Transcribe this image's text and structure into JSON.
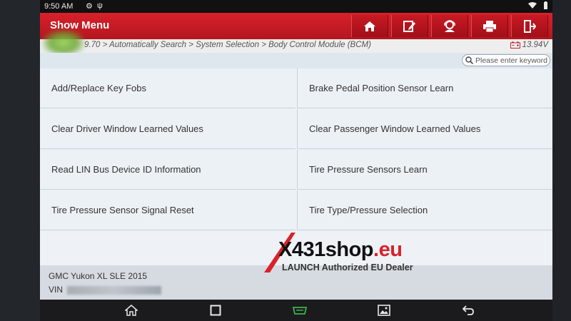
{
  "status": {
    "time": "9:50 AM"
  },
  "header": {
    "title": "Show Menu",
    "tools": [
      "home-icon",
      "edit-icon",
      "support-icon",
      "print-icon",
      "exit-icon"
    ]
  },
  "breadcrumb": {
    "path": "9.70 > Automatically Search > System Selection > Body Control Module (BCM)",
    "voltage": "13.94V"
  },
  "search": {
    "placeholder": "Please enter keyword"
  },
  "menu": {
    "items": [
      "Add/Replace Key Fobs",
      "Brake Pedal Position Sensor Learn",
      "Clear Driver Window Learned Values",
      "Clear Passenger Window Learned Values",
      "Read LIN Bus Device ID Information",
      "Tire Pressure Sensors Learn",
      "Tire Pressure Sensor Signal Reset",
      "Tire Type/Pressure Selection"
    ]
  },
  "vehicle": {
    "model": "GMC Yukon XL SLE 2015",
    "vin_label": "VIN"
  },
  "watermark": {
    "brand_black": "X431",
    "brand_red": "shop",
    "brand_suffix": ".eu",
    "tagline": "LAUNCH Authorized EU Dealer"
  },
  "colors": {
    "header_red": "#c41c26",
    "brand_red": "#d9222b",
    "grid_bg": "#ecf1f6"
  },
  "navbar": [
    "home-icon",
    "recents-icon",
    "vci-icon",
    "screenshot-icon",
    "back-icon"
  ]
}
